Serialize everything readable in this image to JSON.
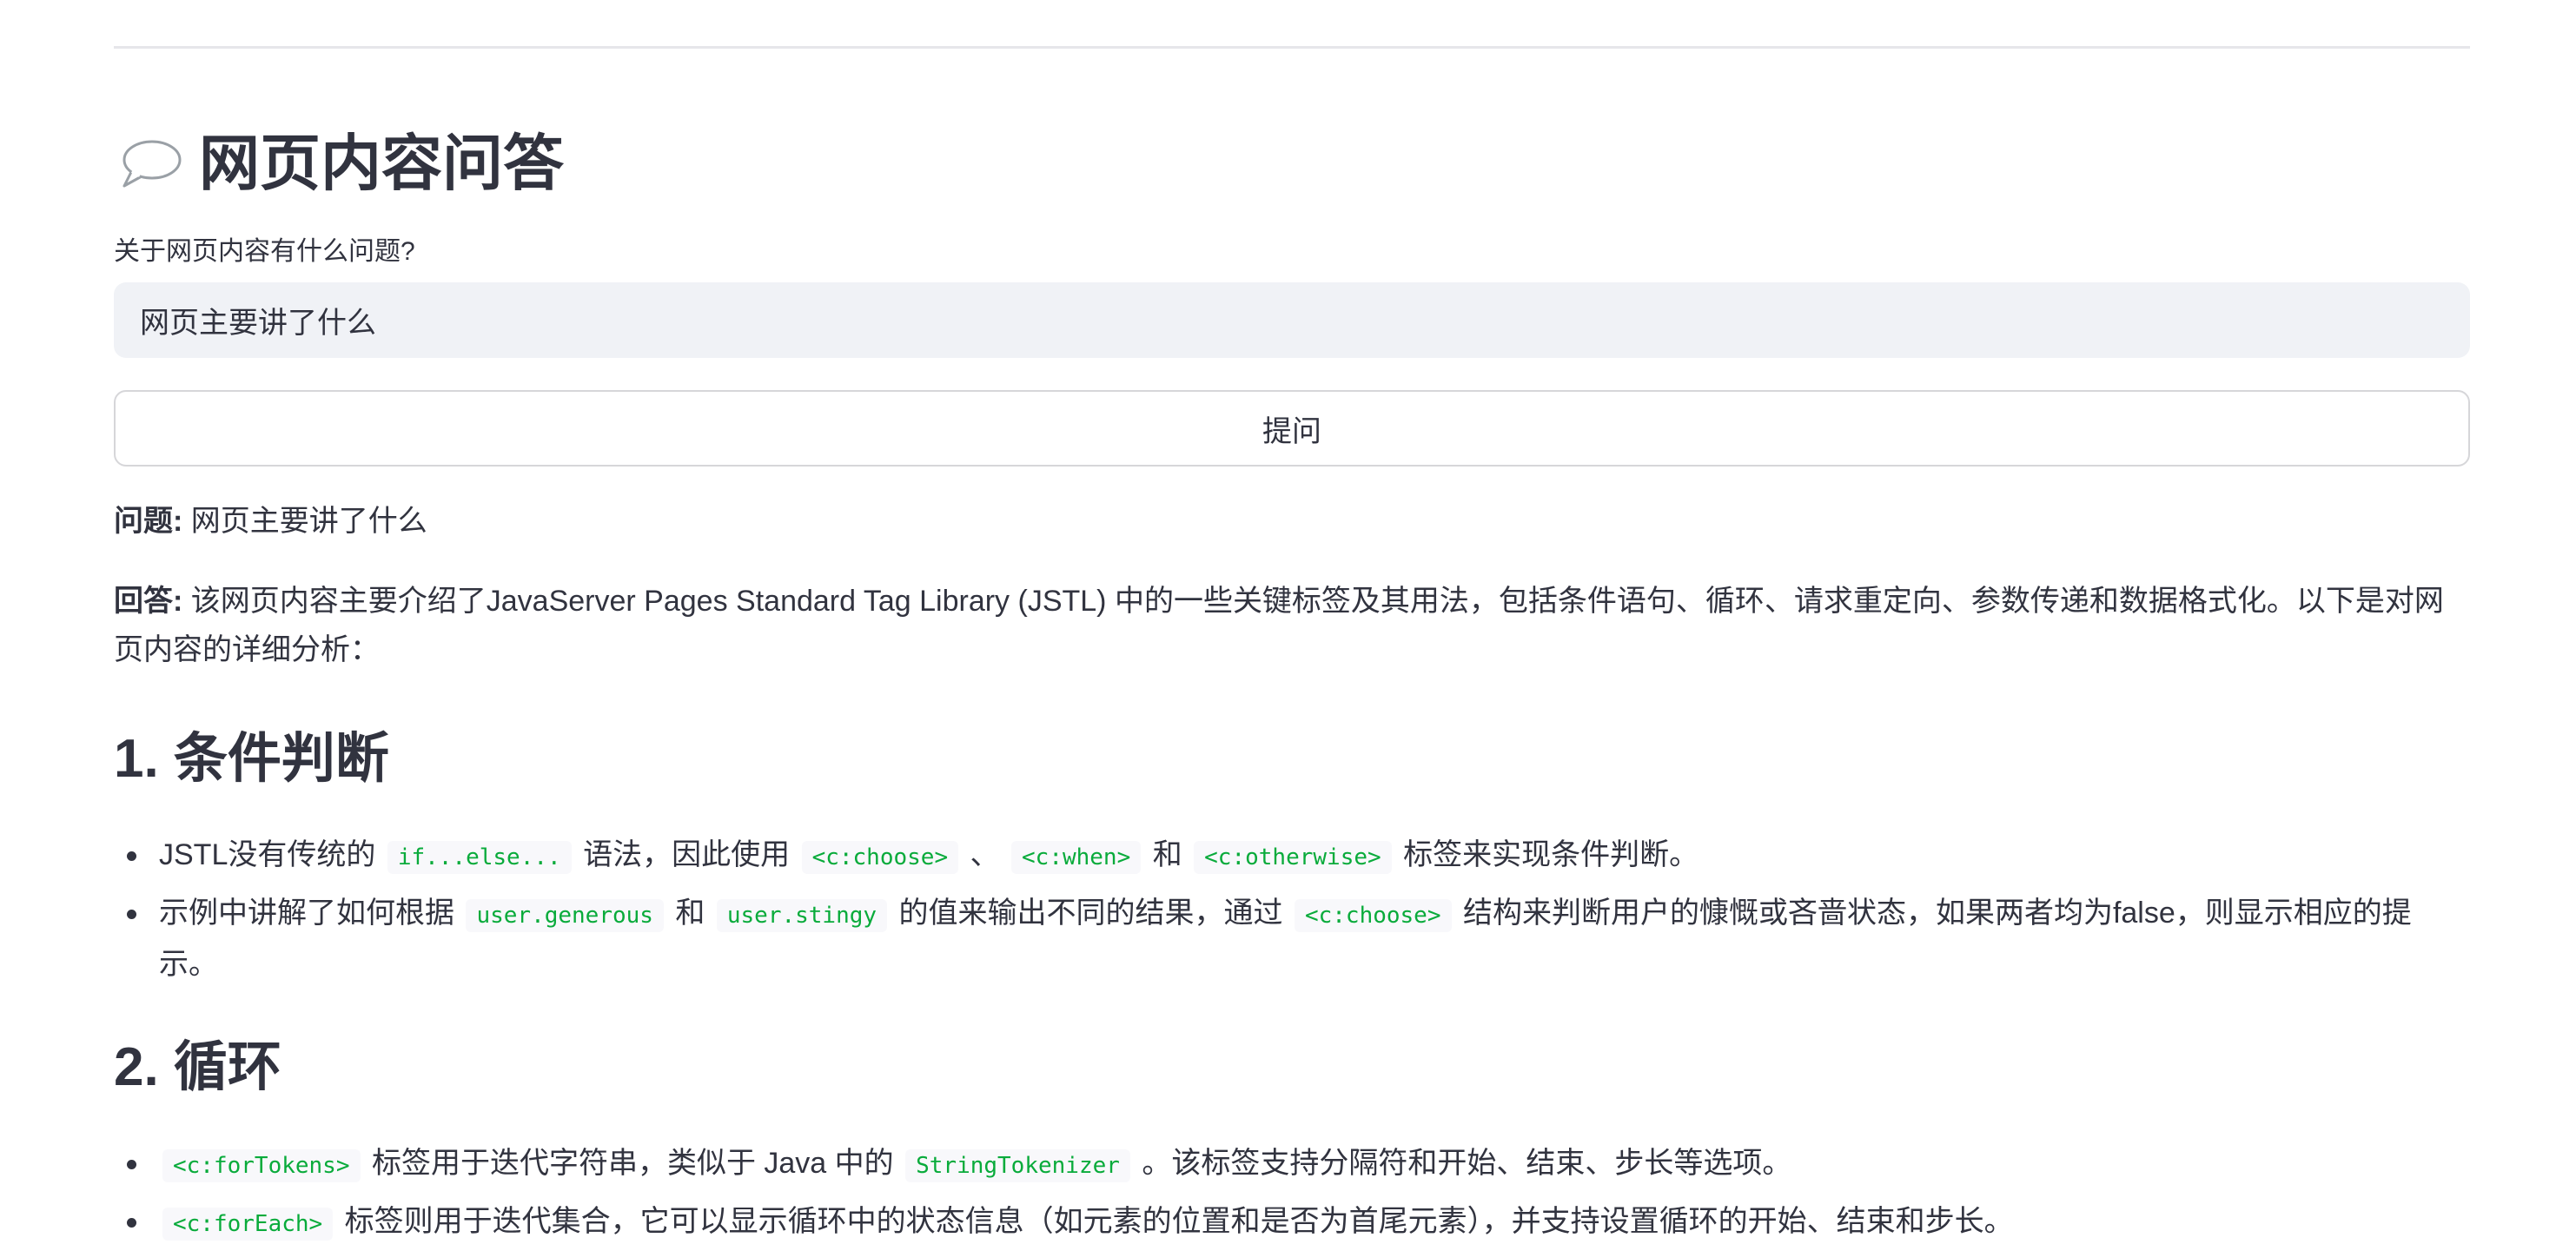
{
  "page": {
    "title": "网页内容问答",
    "title_icon": "speech-bubble-icon"
  },
  "question_form": {
    "label": "关于网页内容有什么问题?",
    "input_value": "网页主要讲了什么",
    "button_label": "提问"
  },
  "qa": {
    "question_label": "问题:",
    "question_text": " 网页主要讲了什么",
    "answer_label": "回答:",
    "answer_text": " 该网页内容主要介绍了JavaServer Pages Standard Tag Library (JSTL) 中的一些关键标签及其用法，包括条件语句、循环、请求重定向、参数传递和数据格式化。以下是对网页内容的详细分析："
  },
  "sections": [
    {
      "heading": "1. 条件判断",
      "items": [
        {
          "parts": [
            {
              "t": "text",
              "v": "JSTL没有传统的 "
            },
            {
              "t": "code",
              "v": "if...else..."
            },
            {
              "t": "text",
              "v": " 语法，因此使用 "
            },
            {
              "t": "code",
              "v": "<c:choose>"
            },
            {
              "t": "text",
              "v": " 、 "
            },
            {
              "t": "code",
              "v": "<c:when>"
            },
            {
              "t": "text",
              "v": " 和 "
            },
            {
              "t": "code",
              "v": "<c:otherwise>"
            },
            {
              "t": "text",
              "v": " 标签来实现条件判断。"
            }
          ]
        },
        {
          "parts": [
            {
              "t": "text",
              "v": "示例中讲解了如何根据 "
            },
            {
              "t": "code",
              "v": "user.generous"
            },
            {
              "t": "text",
              "v": " 和 "
            },
            {
              "t": "code",
              "v": "user.stingy"
            },
            {
              "t": "text",
              "v": " 的值来输出不同的结果，通过 "
            },
            {
              "t": "code",
              "v": "<c:choose>"
            },
            {
              "t": "text",
              "v": " 结构来判断用户的慷慨或吝啬状态，如果两者均为false，则显示相应的提示。"
            }
          ]
        }
      ]
    },
    {
      "heading": "2. 循环",
      "items": [
        {
          "parts": [
            {
              "t": "code",
              "v": "<c:forTokens>"
            },
            {
              "t": "text",
              "v": " 标签用于迭代字符串，类似于 Java 中的 "
            },
            {
              "t": "code",
              "v": "StringTokenizer"
            },
            {
              "t": "text",
              "v": " 。该标签支持分隔符和开始、结束、步长等选项。"
            }
          ]
        },
        {
          "parts": [
            {
              "t": "code",
              "v": "<c:forEach>"
            },
            {
              "t": "text",
              "v": " 标签则用于迭代集合，它可以显示循环中的状态信息（如元素的位置和是否为首尾元素），并支持设置循环的开始、结束和步长。"
            }
          ]
        }
      ]
    }
  ]
}
